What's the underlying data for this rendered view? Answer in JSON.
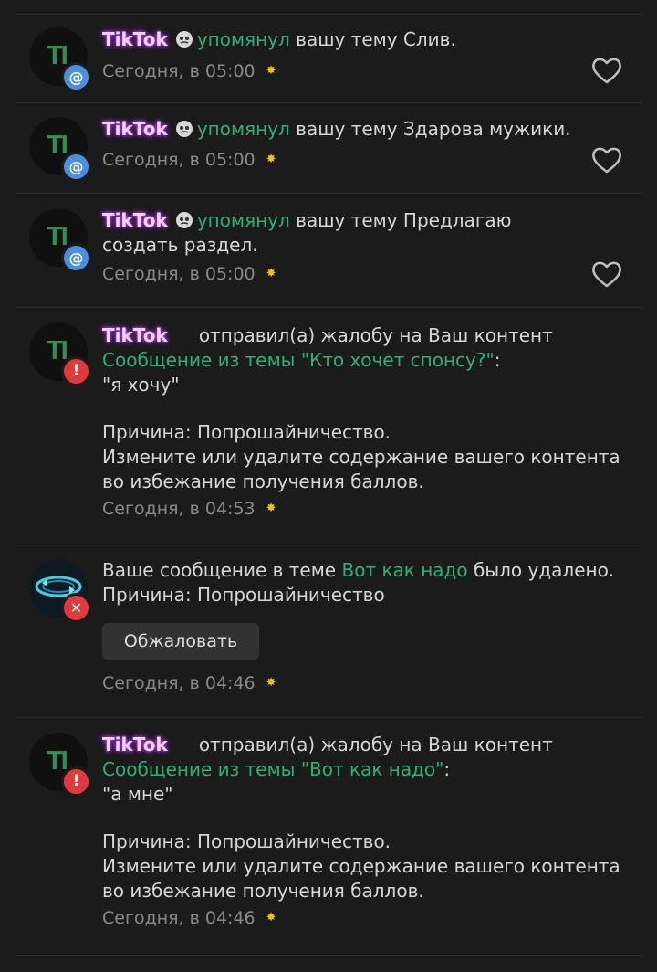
{
  "notifications": [
    {
      "user": "TikTok",
      "verb": "упомянул",
      "text": "вашу тему Слив.",
      "time": "Сегодня, в 05:00",
      "badge": "@"
    },
    {
      "user": "TikTok",
      "verb": "упомянул",
      "text": "вашу тему Здарова мужики.",
      "time": "Сегодня, в 05:00",
      "badge": "@"
    },
    {
      "user": "TikTok",
      "verb": "упомянул",
      "text": "вашу тему Предлагаю создать раздел.",
      "time": "Сегодня, в 05:00",
      "badge": "@"
    },
    {
      "user": "TikTok",
      "action": "отправил(а) жалобу на Ваш контент",
      "link": "Сообщение из темы \"Кто хочет спонсу?\"",
      "colon": ":",
      "quote": "\"я хочу\"",
      "reason": "Причина: Попрошайничество.",
      "advice": "Измените или удалите содержание вашего контента во избежание получения баллов.",
      "time": "Сегодня, в 04:53",
      "badge": "!"
    },
    {
      "prefix": "Ваше сообщение в теме",
      "link": "Вот как надо",
      "suffix": "было удалено.",
      "reason": "Причина: Попрошайничество",
      "appeal_label": "Обжаловать",
      "time": "Сегодня, в 04:46",
      "badge": "✕"
    },
    {
      "user": "TikTok",
      "action": "отправил(а) жалобу на Ваш контент",
      "link": "Сообщение из темы \"Вот как надо\"",
      "colon": ":",
      "quote": "\"а мне\"",
      "reason": "Причина: Попрошайничество.",
      "advice": "Измените или удалите содержание вашего контента во избежание получения баллов.",
      "time": "Сегодня, в 04:46",
      "badge": "!"
    }
  ],
  "avatar_letters": "TI",
  "colors": {
    "background": "#1b1b1b",
    "link": "#2fb074",
    "mention_badge": "#4a8fe0",
    "alert_badge": "#e23a3a",
    "star": "#e6c21e"
  },
  "icons": [
    "heart-outline-icon",
    "star-icon",
    "at-icon",
    "exclamation-icon",
    "close-icon"
  ]
}
